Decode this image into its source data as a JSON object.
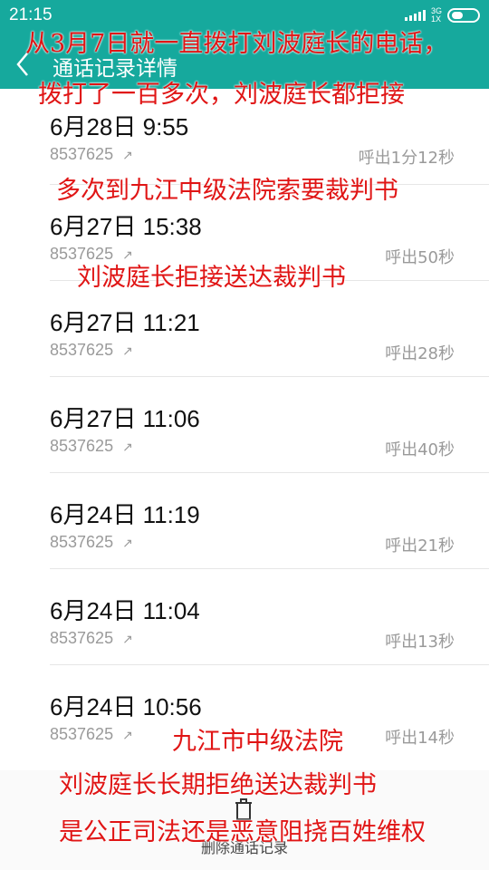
{
  "status_bar": {
    "time": "21:15",
    "network": [
      "3G",
      "1X"
    ]
  },
  "header": {
    "title": "通话记录详情"
  },
  "calls": [
    {
      "date": "6月28日 9:55",
      "number": "8537625",
      "status": "呼出1分12秒"
    },
    {
      "date": "6月27日 15:38",
      "number": "8537625",
      "status": "呼出50秒"
    },
    {
      "date": "6月27日 11:21",
      "number": "8537625",
      "status": "呼出28秒"
    },
    {
      "date": "6月27日 11:06",
      "number": "8537625",
      "status": "呼出40秒"
    },
    {
      "date": "6月24日 11:19",
      "number": "8537625",
      "status": "呼出21秒"
    },
    {
      "date": "6月24日 11:04",
      "number": "8537625",
      "status": "呼出13秒"
    },
    {
      "date": "6月24日 10:56",
      "number": "8537625",
      "status": "呼出14秒"
    }
  ],
  "bottom_bar": {
    "delete_label": "删除通话记录"
  },
  "annotations": {
    "line1": "从3月7日就一直拨打刘波庭长的电话，",
    "line2": "拨打了一百多次，刘波庭长都拒接",
    "line3": "多次到九江中级法院索要裁判书",
    "line4": "刘波庭长拒接送达裁判书",
    "line5": "九江市中级法院",
    "line6": "刘波庭长长期拒绝送达裁判书",
    "line7": "是公正司法还是恶意阻挠百姓维权"
  },
  "colors": {
    "header": "#16a99d",
    "annotation": "#e01515",
    "secondary_text": "#9a9a9a"
  }
}
